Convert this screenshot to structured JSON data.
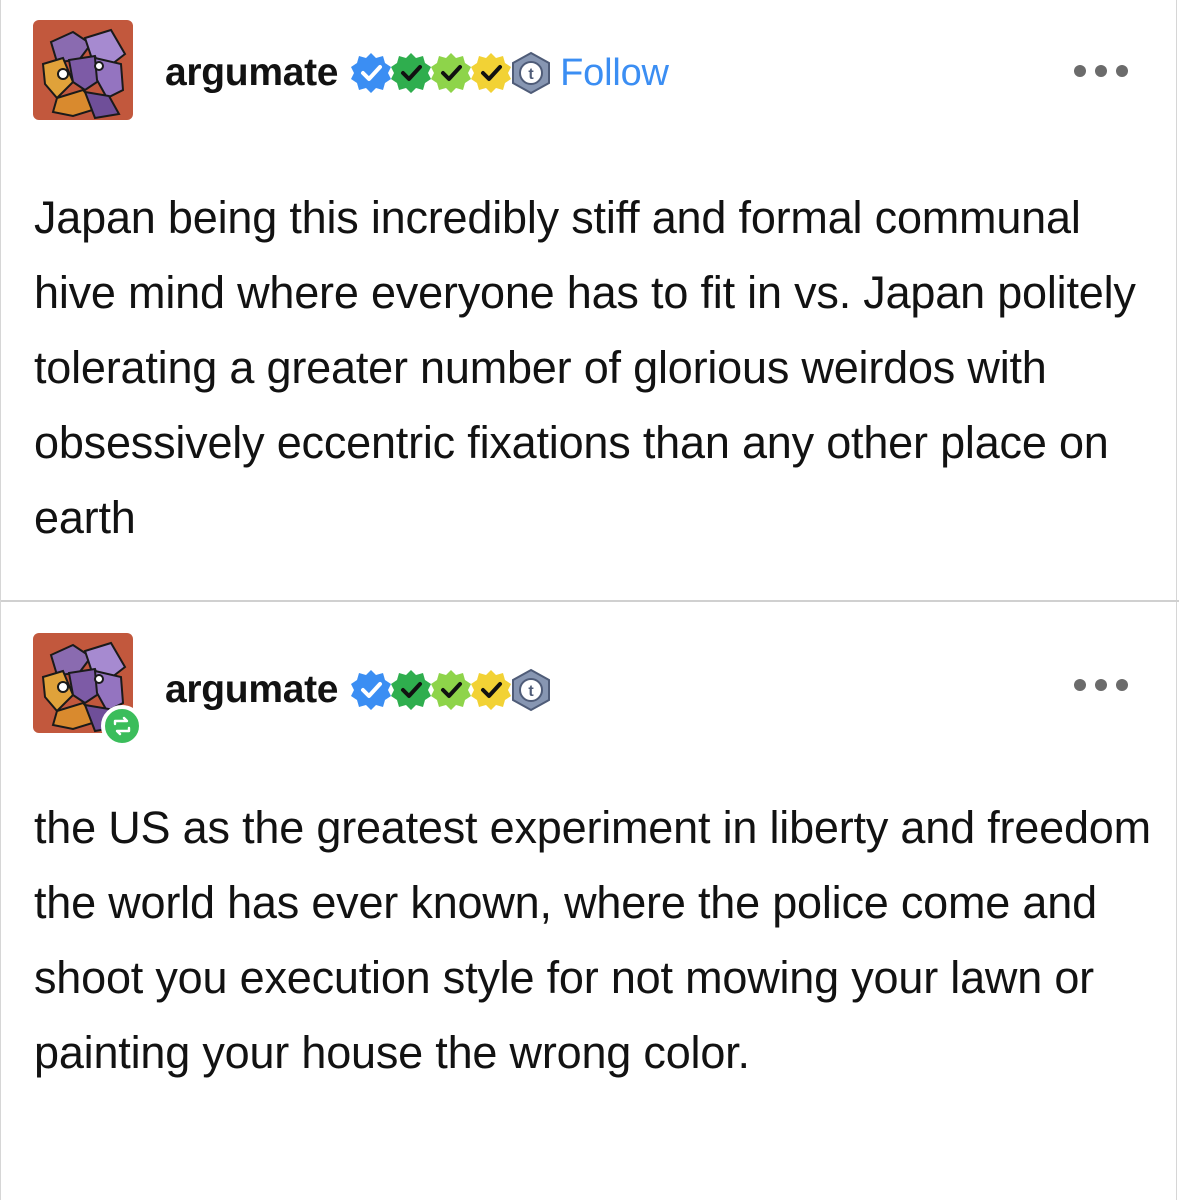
{
  "posts": [
    {
      "username": "argumate",
      "follow_label": "Follow",
      "more_icon": "more-horizontal-icon",
      "badges": [
        "verified-blue",
        "check-green",
        "check-lime",
        "check-yellow",
        "tumblr-t"
      ],
      "body": "Japan being this incredibly stiff and formal communal hive mind where everyone has to fit in vs. Japan politely tolerating a greater number of glorious weirdos with obsessively eccentric fixations than any other place on earth"
    },
    {
      "username": "argumate",
      "reblog_icon": "reblog-icon",
      "more_icon": "more-horizontal-icon",
      "badges": [
        "verified-blue",
        "check-green",
        "check-lime",
        "check-yellow",
        "tumblr-t"
      ],
      "body": "the US as the greatest experiment in liberty and freedom the world has ever known, where the police come and shoot you execution style for not mowing your lawn or painting your house the wrong color."
    }
  ],
  "colors": {
    "follow": "#3b8ef3",
    "text": "#121212",
    "divider": "#d0d0d0",
    "reblog_badge": "#3bbd5b"
  }
}
